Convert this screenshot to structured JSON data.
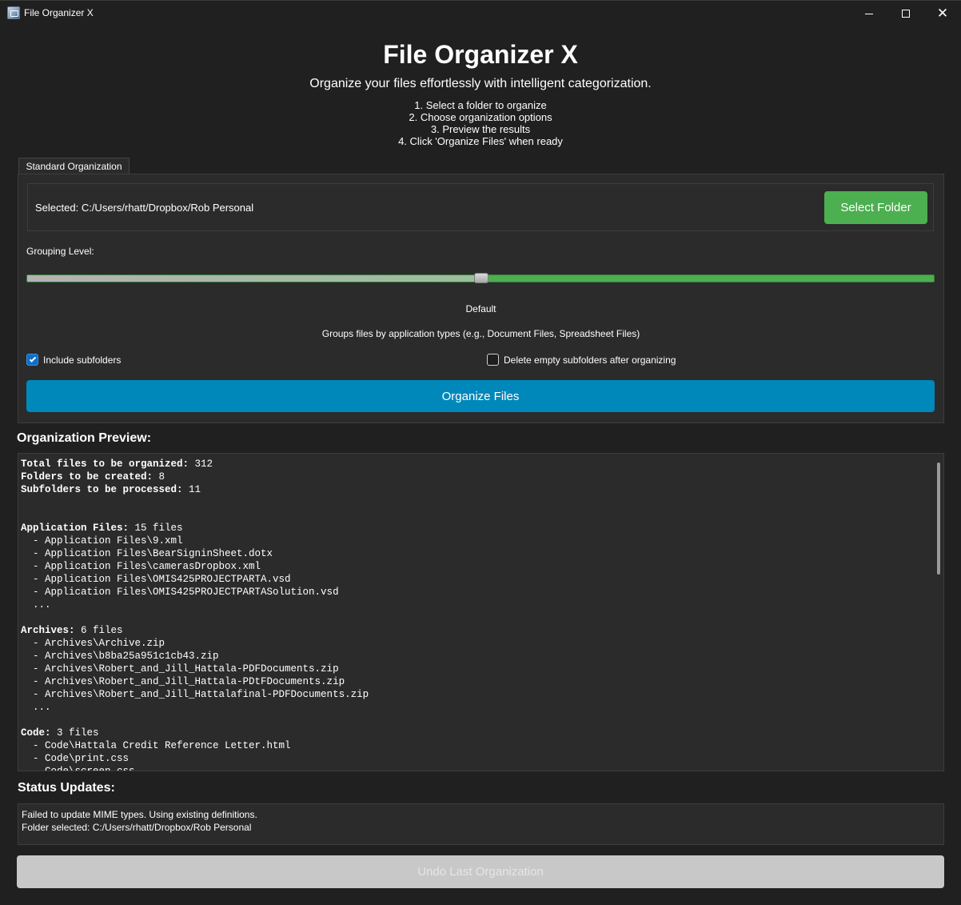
{
  "window": {
    "title": "File Organizer X",
    "controls": {
      "minimize": "minimize-icon",
      "maximize": "maximize-icon",
      "close": "close-icon",
      "close_glyph": "✕"
    }
  },
  "header": {
    "title": "File Organizer X",
    "subtitle": "Organize your files effortlessly with intelligent categorization.",
    "steps": [
      "1. Select a folder to organize",
      "2. Choose organization options",
      "3. Preview the results",
      "4. Click 'Organize Files' when ready"
    ]
  },
  "tabs": [
    {
      "label": "Standard Organization",
      "active": true
    }
  ],
  "folder": {
    "selected_text": "Selected: C:/Users/rhatt/Dropbox/Rob Personal",
    "select_button": "Select Folder"
  },
  "grouping": {
    "label": "Grouping Level:",
    "slider_value": 0.5,
    "level_name": "Default",
    "description": "Groups files by application types (e.g., Document Files, Spreadsheet Files)"
  },
  "options": {
    "include_subfolders": {
      "label": "Include subfolders",
      "checked": true
    },
    "delete_empty": {
      "label": "Delete empty subfolders after organizing",
      "checked": false
    }
  },
  "organize_button": "Organize Files",
  "preview": {
    "title": "Organization Preview:",
    "lines": [
      {
        "key": "Total files to be organized:",
        "value": " 312"
      },
      {
        "key": "Folders to be created:",
        "value": " 8"
      },
      {
        "key": "Subfolders to be processed:",
        "value": " 11"
      },
      {
        "key": "",
        "value": ""
      },
      {
        "key": "",
        "value": ""
      },
      {
        "key": "Application Files:",
        "value": " 15 files"
      },
      {
        "key": "",
        "value": "  - Application Files\\9.xml"
      },
      {
        "key": "",
        "value": "  - Application Files\\BearSigninSheet.dotx"
      },
      {
        "key": "",
        "value": "  - Application Files\\camerasDropbox.xml"
      },
      {
        "key": "",
        "value": "  - Application Files\\OMIS425PROJECTPARTA.vsd"
      },
      {
        "key": "",
        "value": "  - Application Files\\OMIS425PROJECTPARTASolution.vsd"
      },
      {
        "key": "",
        "value": "  ..."
      },
      {
        "key": "",
        "value": ""
      },
      {
        "key": "Archives:",
        "value": " 6 files"
      },
      {
        "key": "",
        "value": "  - Archives\\Archive.zip"
      },
      {
        "key": "",
        "value": "  - Archives\\b8ba25a951c1cb43.zip"
      },
      {
        "key": "",
        "value": "  - Archives\\Robert_and_Jill_Hattala-PDFDocuments.zip"
      },
      {
        "key": "",
        "value": "  - Archives\\Robert_and_Jill_Hattala-PDtFDocuments.zip"
      },
      {
        "key": "",
        "value": "  - Archives\\Robert_and_Jill_Hattalafinal-PDFDocuments.zip"
      },
      {
        "key": "",
        "value": "  ..."
      },
      {
        "key": "",
        "value": ""
      },
      {
        "key": "Code:",
        "value": " 3 files"
      },
      {
        "key": "",
        "value": "  - Code\\Hattala Credit Reference Letter.html"
      },
      {
        "key": "",
        "value": "  - Code\\print.css"
      },
      {
        "key": "",
        "value": "  - Code\\screen.css"
      }
    ]
  },
  "status": {
    "title": "Status Updates:",
    "lines": [
      "Failed to update MIME types. Using existing definitions.",
      "Folder selected: C:/Users/rhatt/Dropbox/Rob Personal"
    ]
  },
  "undo_button": "Undo Last Organization",
  "colors": {
    "background": "#202020",
    "panel": "#2b2b2b",
    "select_button": "#4caf50",
    "organize_button": "#0088bb",
    "undo_button_disabled": "#c8c8c8",
    "checkbox_checked": "#0b6fc9"
  }
}
